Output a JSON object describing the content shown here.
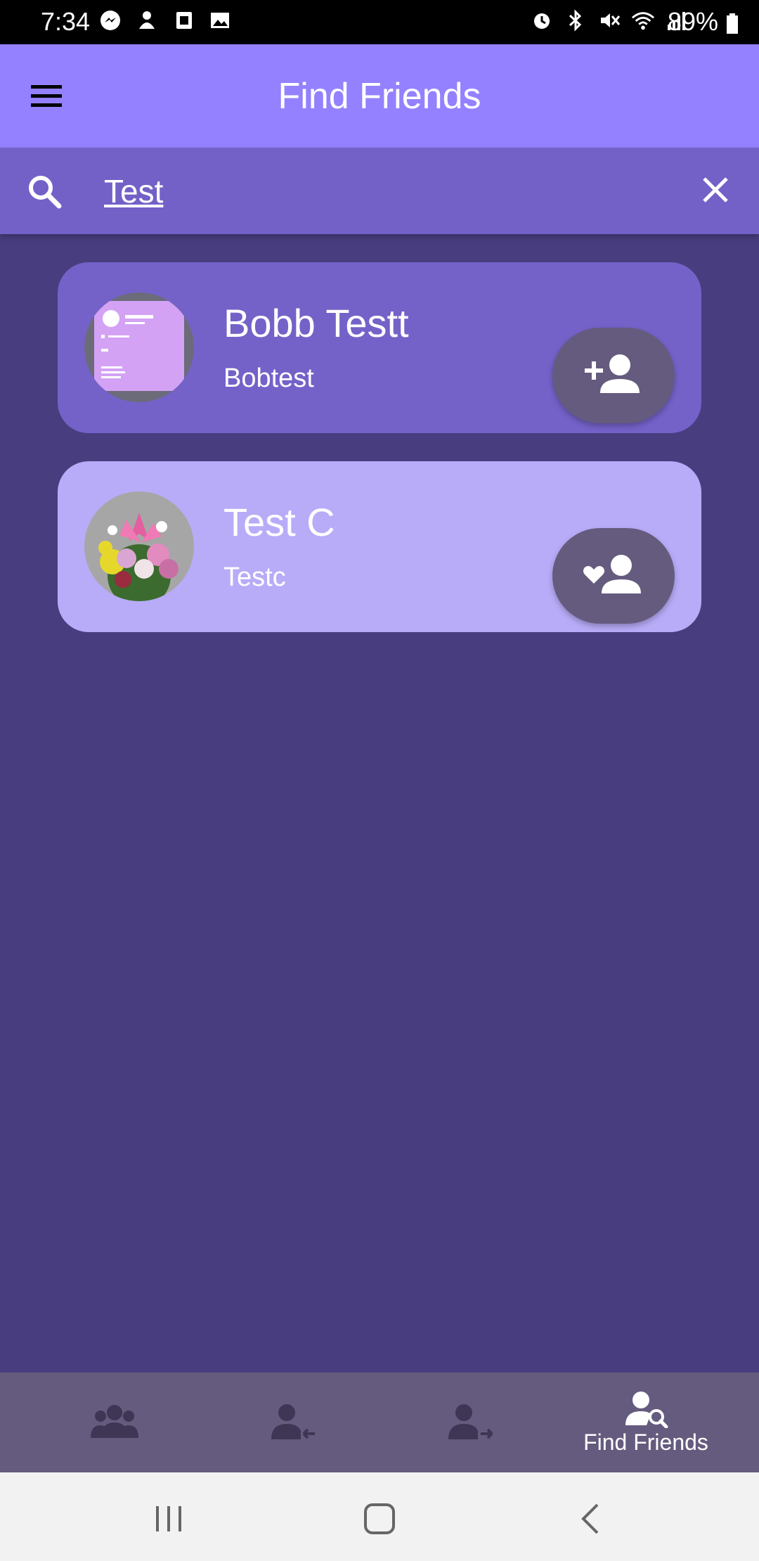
{
  "status_bar": {
    "time": "7:34",
    "battery": "89%",
    "left_icons": [
      "messenger-icon",
      "notification-icon",
      "sim-icon",
      "gallery-icon"
    ],
    "right_icons": [
      "alarm-icon",
      "bluetooth-icon",
      "mute-icon",
      "wifi-icon",
      "signal-icon",
      "battery-icon"
    ]
  },
  "app_bar": {
    "title": "Find Friends",
    "menu_icon": "menu-icon"
  },
  "search": {
    "value": "Test",
    "placeholder": "",
    "search_icon": "search-icon",
    "clear_icon": "close-icon"
  },
  "results": [
    {
      "name": "Bobb Testt",
      "username": "Bobtest",
      "action_icon": "add-friend-icon"
    },
    {
      "name": "Test C",
      "username": "Testc",
      "action_icon": "friend-favorite-icon"
    }
  ],
  "bottom_nav": {
    "items": [
      {
        "icon": "friends-icon",
        "label": ""
      },
      {
        "icon": "incoming-requests-icon",
        "label": ""
      },
      {
        "icon": "outgoing-requests-icon",
        "label": ""
      },
      {
        "icon": "find-friends-icon",
        "label": "Find Friends"
      }
    ]
  },
  "colors": {
    "app_bar": "#9381ff",
    "search_bar": "#7361c8",
    "background": "#483e7f",
    "card_1": "#7462c9",
    "card_2": "#b8acf8",
    "action_button": "#655b7e",
    "bottom_nav": "#655b7e"
  }
}
